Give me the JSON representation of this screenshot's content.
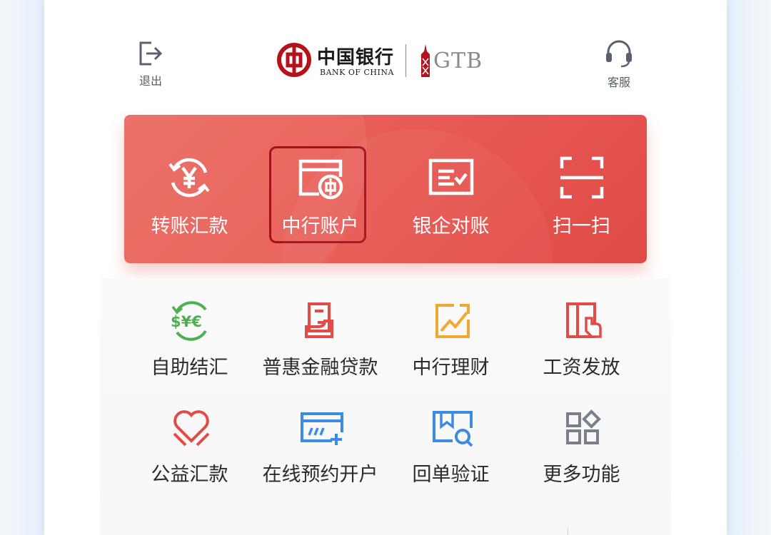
{
  "header": {
    "logout_label": "退出",
    "service_label": "客服",
    "bank_name_cn": "中国银行",
    "bank_name_en": "BANK OF CHINA",
    "gtb_label": "GTB"
  },
  "card": {
    "items": [
      {
        "label": "转账汇款",
        "icon": "yen-exchange-icon"
      },
      {
        "label": "中行账户",
        "icon": "boc-account-card-icon",
        "selected": true
      },
      {
        "label": "银企对账",
        "icon": "reconciliation-icon"
      },
      {
        "label": "扫一扫",
        "icon": "scan-icon"
      }
    ]
  },
  "grid": {
    "items": [
      {
        "label": "自助结汇",
        "icon": "currency-exchange-icon",
        "color": "#4caf50"
      },
      {
        "label": "普惠金融贷款",
        "icon": "loan-icon",
        "color": "#e34b47"
      },
      {
        "label": "中行理财",
        "icon": "wealth-chart-icon",
        "color": "#f0a830"
      },
      {
        "label": "工资发放",
        "icon": "payroll-icon",
        "color": "#e34b47"
      },
      {
        "label": "公益汇款",
        "icon": "charity-heart-icon",
        "color": "#e34b47"
      },
      {
        "label": "在线预约开户",
        "icon": "online-booking-icon",
        "color": "#3b8ae6"
      },
      {
        "label": "回单验证",
        "icon": "receipt-verify-icon",
        "color": "#3b8ae6"
      },
      {
        "label": "更多功能",
        "icon": "more-functions-icon",
        "color": "#7a7f8c"
      }
    ]
  },
  "colors": {
    "card_red": "#e85a54",
    "highlight": "#a3111b"
  }
}
